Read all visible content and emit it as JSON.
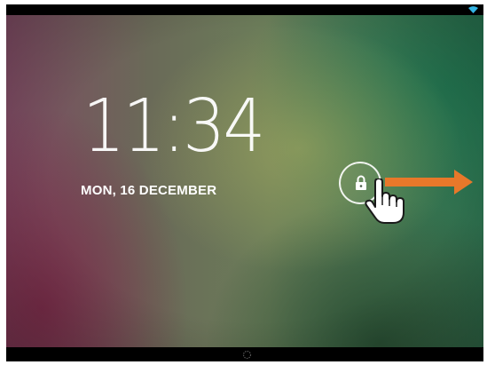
{
  "lockscreen": {
    "time": "11:34",
    "date": "MON, 16 DECEMBER"
  },
  "status_bar": {
    "icons": [
      "wifi-icon"
    ]
  },
  "unlock": {
    "icon": "lock-icon",
    "gesture_hint": "hand-pointer-icon",
    "direction_hint": "arrow-right-icon"
  },
  "colors": {
    "arrow": "#e8782a",
    "text": "#ffffff",
    "wifi": "#33b5e5"
  }
}
